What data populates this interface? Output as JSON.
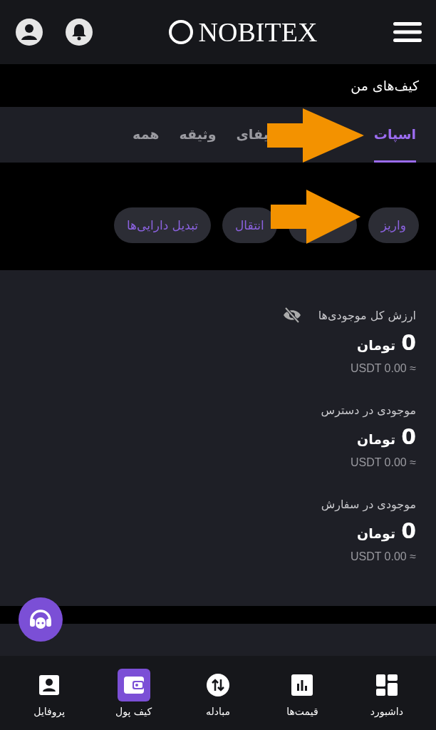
{
  "header": {
    "logo": "NOBITEX"
  },
  "page_title": "کیف‌های من",
  "tabs": [
    {
      "label": "اسپات",
      "selected": true
    },
    {
      "label": "یفای",
      "selected": false
    },
    {
      "label": "وثیقه",
      "selected": false
    },
    {
      "label": "همه",
      "selected": false
    }
  ],
  "actions": [
    {
      "kind": "labeled",
      "label": "واریز"
    },
    {
      "kind": "blank"
    },
    {
      "kind": "labeled",
      "label": "انتقال"
    },
    {
      "kind": "labeled",
      "label": "تبدیل دارایی‌ها"
    }
  ],
  "balances": [
    {
      "label": "ارزش کل موجودی‌ها",
      "hide_toggle": true,
      "amount": "0",
      "unit": "تومان",
      "usdt": "≈ USDT 0.00"
    },
    {
      "label": "موجودی در دسترس",
      "hide_toggle": false,
      "amount": "0",
      "unit": "تومان",
      "usdt": "≈ USDT 0.00"
    },
    {
      "label": "موجودی در سفارش",
      "hide_toggle": false,
      "amount": "0",
      "unit": "تومان",
      "usdt": "≈ USDT 0.00"
    }
  ],
  "bottom_nav": [
    {
      "label": "داشبورد",
      "kind": "dashboard",
      "selected": false
    },
    {
      "label": "قیمت‌ها",
      "kind": "chart",
      "selected": false
    },
    {
      "label": "مبادله",
      "kind": "swap",
      "selected": false
    },
    {
      "label": "کیف پول",
      "kind": "wallet",
      "selected": true
    },
    {
      "label": "پروفایل",
      "kind": "profile",
      "selected": false
    }
  ]
}
